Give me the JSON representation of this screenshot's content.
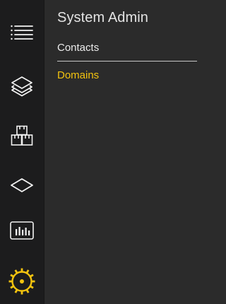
{
  "icons": {
    "menu": "menu-lines-icon",
    "layers": "layers-icon",
    "boxes": "stacked-boxes-icon",
    "diamond": "diamond-icon",
    "stats": "bar-chart-icon",
    "settings": "gear-icon"
  },
  "colors": {
    "rail_bg": "#1c1c1d",
    "panel_bg": "#2b2b2b",
    "icon_default": "#f2f2f2",
    "accent": "#f3c30f",
    "text": "#ececec"
  },
  "panel": {
    "title": "System Admin",
    "items": [
      {
        "label": "Contacts",
        "active": false
      },
      {
        "label": "Domains",
        "active": true
      }
    ]
  }
}
